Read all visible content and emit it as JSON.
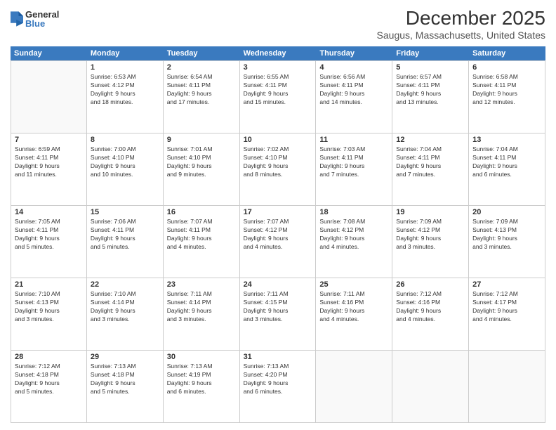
{
  "logo": {
    "general": "General",
    "blue": "Blue"
  },
  "title": "December 2025",
  "subtitle": "Saugus, Massachusetts, United States",
  "header_days": [
    "Sunday",
    "Monday",
    "Tuesday",
    "Wednesday",
    "Thursday",
    "Friday",
    "Saturday"
  ],
  "weeks": [
    [
      {
        "day": "",
        "lines": []
      },
      {
        "day": "1",
        "lines": [
          "Sunrise: 6:53 AM",
          "Sunset: 4:12 PM",
          "Daylight: 9 hours",
          "and 18 minutes."
        ]
      },
      {
        "day": "2",
        "lines": [
          "Sunrise: 6:54 AM",
          "Sunset: 4:11 PM",
          "Daylight: 9 hours",
          "and 17 minutes."
        ]
      },
      {
        "day": "3",
        "lines": [
          "Sunrise: 6:55 AM",
          "Sunset: 4:11 PM",
          "Daylight: 9 hours",
          "and 15 minutes."
        ]
      },
      {
        "day": "4",
        "lines": [
          "Sunrise: 6:56 AM",
          "Sunset: 4:11 PM",
          "Daylight: 9 hours",
          "and 14 minutes."
        ]
      },
      {
        "day": "5",
        "lines": [
          "Sunrise: 6:57 AM",
          "Sunset: 4:11 PM",
          "Daylight: 9 hours",
          "and 13 minutes."
        ]
      },
      {
        "day": "6",
        "lines": [
          "Sunrise: 6:58 AM",
          "Sunset: 4:11 PM",
          "Daylight: 9 hours",
          "and 12 minutes."
        ]
      }
    ],
    [
      {
        "day": "7",
        "lines": [
          "Sunrise: 6:59 AM",
          "Sunset: 4:11 PM",
          "Daylight: 9 hours",
          "and 11 minutes."
        ]
      },
      {
        "day": "8",
        "lines": [
          "Sunrise: 7:00 AM",
          "Sunset: 4:10 PM",
          "Daylight: 9 hours",
          "and 10 minutes."
        ]
      },
      {
        "day": "9",
        "lines": [
          "Sunrise: 7:01 AM",
          "Sunset: 4:10 PM",
          "Daylight: 9 hours",
          "and 9 minutes."
        ]
      },
      {
        "day": "10",
        "lines": [
          "Sunrise: 7:02 AM",
          "Sunset: 4:10 PM",
          "Daylight: 9 hours",
          "and 8 minutes."
        ]
      },
      {
        "day": "11",
        "lines": [
          "Sunrise: 7:03 AM",
          "Sunset: 4:11 PM",
          "Daylight: 9 hours",
          "and 7 minutes."
        ]
      },
      {
        "day": "12",
        "lines": [
          "Sunrise: 7:04 AM",
          "Sunset: 4:11 PM",
          "Daylight: 9 hours",
          "and 7 minutes."
        ]
      },
      {
        "day": "13",
        "lines": [
          "Sunrise: 7:04 AM",
          "Sunset: 4:11 PM",
          "Daylight: 9 hours",
          "and 6 minutes."
        ]
      }
    ],
    [
      {
        "day": "14",
        "lines": [
          "Sunrise: 7:05 AM",
          "Sunset: 4:11 PM",
          "Daylight: 9 hours",
          "and 5 minutes."
        ]
      },
      {
        "day": "15",
        "lines": [
          "Sunrise: 7:06 AM",
          "Sunset: 4:11 PM",
          "Daylight: 9 hours",
          "and 5 minutes."
        ]
      },
      {
        "day": "16",
        "lines": [
          "Sunrise: 7:07 AM",
          "Sunset: 4:11 PM",
          "Daylight: 9 hours",
          "and 4 minutes."
        ]
      },
      {
        "day": "17",
        "lines": [
          "Sunrise: 7:07 AM",
          "Sunset: 4:12 PM",
          "Daylight: 9 hours",
          "and 4 minutes."
        ]
      },
      {
        "day": "18",
        "lines": [
          "Sunrise: 7:08 AM",
          "Sunset: 4:12 PM",
          "Daylight: 9 hours",
          "and 4 minutes."
        ]
      },
      {
        "day": "19",
        "lines": [
          "Sunrise: 7:09 AM",
          "Sunset: 4:12 PM",
          "Daylight: 9 hours",
          "and 3 minutes."
        ]
      },
      {
        "day": "20",
        "lines": [
          "Sunrise: 7:09 AM",
          "Sunset: 4:13 PM",
          "Daylight: 9 hours",
          "and 3 minutes."
        ]
      }
    ],
    [
      {
        "day": "21",
        "lines": [
          "Sunrise: 7:10 AM",
          "Sunset: 4:13 PM",
          "Daylight: 9 hours",
          "and 3 minutes."
        ]
      },
      {
        "day": "22",
        "lines": [
          "Sunrise: 7:10 AM",
          "Sunset: 4:14 PM",
          "Daylight: 9 hours",
          "and 3 minutes."
        ]
      },
      {
        "day": "23",
        "lines": [
          "Sunrise: 7:11 AM",
          "Sunset: 4:14 PM",
          "Daylight: 9 hours",
          "and 3 minutes."
        ]
      },
      {
        "day": "24",
        "lines": [
          "Sunrise: 7:11 AM",
          "Sunset: 4:15 PM",
          "Daylight: 9 hours",
          "and 3 minutes."
        ]
      },
      {
        "day": "25",
        "lines": [
          "Sunrise: 7:11 AM",
          "Sunset: 4:16 PM",
          "Daylight: 9 hours",
          "and 4 minutes."
        ]
      },
      {
        "day": "26",
        "lines": [
          "Sunrise: 7:12 AM",
          "Sunset: 4:16 PM",
          "Daylight: 9 hours",
          "and 4 minutes."
        ]
      },
      {
        "day": "27",
        "lines": [
          "Sunrise: 7:12 AM",
          "Sunset: 4:17 PM",
          "Daylight: 9 hours",
          "and 4 minutes."
        ]
      }
    ],
    [
      {
        "day": "28",
        "lines": [
          "Sunrise: 7:12 AM",
          "Sunset: 4:18 PM",
          "Daylight: 9 hours",
          "and 5 minutes."
        ]
      },
      {
        "day": "29",
        "lines": [
          "Sunrise: 7:13 AM",
          "Sunset: 4:18 PM",
          "Daylight: 9 hours",
          "and 5 minutes."
        ]
      },
      {
        "day": "30",
        "lines": [
          "Sunrise: 7:13 AM",
          "Sunset: 4:19 PM",
          "Daylight: 9 hours",
          "and 6 minutes."
        ]
      },
      {
        "day": "31",
        "lines": [
          "Sunrise: 7:13 AM",
          "Sunset: 4:20 PM",
          "Daylight: 9 hours",
          "and 6 minutes."
        ]
      },
      {
        "day": "",
        "lines": []
      },
      {
        "day": "",
        "lines": []
      },
      {
        "day": "",
        "lines": []
      }
    ]
  ]
}
